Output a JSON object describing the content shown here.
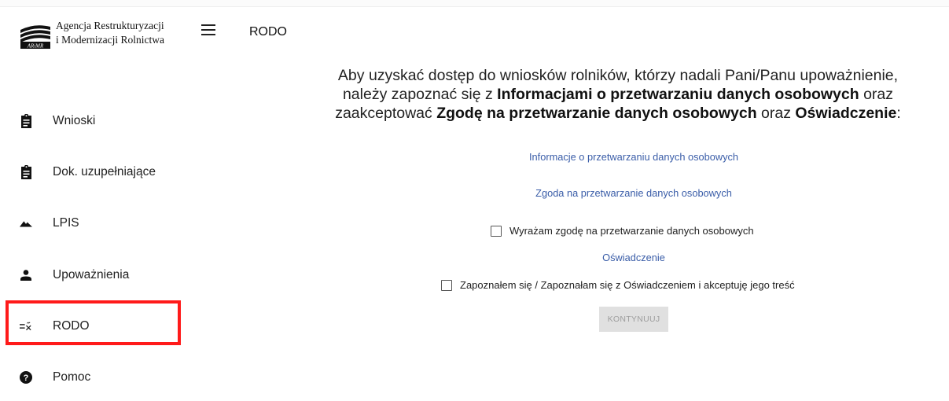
{
  "header": {
    "logo_text": "ARiMR",
    "org_line1": "Agencja Restrukturyzacji",
    "org_line2": "i Modernizacji Rolnictwa",
    "page_title": "RODO"
  },
  "sidebar": {
    "items": [
      {
        "label": "Wnioski",
        "icon": "clipboard-icon"
      },
      {
        "label": "Dok. uzupełniające",
        "icon": "clipboard-icon"
      },
      {
        "label": "LPIS",
        "icon": "mountain-icon"
      },
      {
        "label": "Upoważnienia",
        "icon": "person-icon"
      },
      {
        "label": "RODO",
        "icon": "rule-icon",
        "highlighted": true
      },
      {
        "label": "Pomoc",
        "icon": "help-icon"
      }
    ]
  },
  "main": {
    "intro": {
      "line1": "Aby uzyskać dostęp do wniosków rolników, którzy nadali Pani/Panu upoważnienie,",
      "line2_pre": "należy zapoznać się z ",
      "line2_bold": "Informacjami o przetwarzaniu danych osobowych",
      "line2_post": " oraz",
      "line3_pre": "zaakceptować ",
      "line3_bold1": "Zgodę na przetwarzanie danych osobowych",
      "line3_mid": " oraz ",
      "line3_bold2": "Oświadczenie",
      "line3_post": ":"
    },
    "link_info": "Informacje o przetwarzaniu danych osobowych",
    "link_consent": "Zgoda na przetwarzanie danych osobowych",
    "checkbox_consent": "Wyrażam zgodę na przetwarzanie danych osobowych",
    "link_statement": "Oświadczenie",
    "checkbox_statement": "Zapoznałem się / Zapoznałam się z Oświadczeniem i akceptuję jego treść",
    "continue_button": "KONTYNUUJ"
  },
  "colors": {
    "link": "#3a5da8",
    "highlight": "#ff1a1a",
    "button_disabled_bg": "#e0e0e0",
    "button_disabled_text": "#9e9e9e"
  }
}
